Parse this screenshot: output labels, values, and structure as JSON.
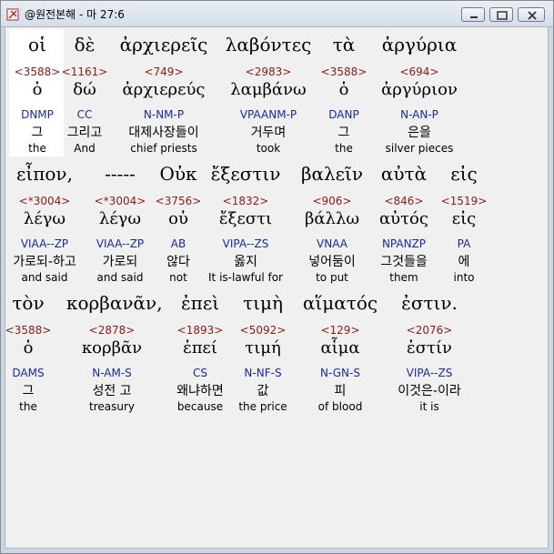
{
  "window": {
    "title": "@원전본해 - 마 27:6"
  },
  "rows": [
    [
      {
        "greek": "οἱ",
        "strong": "<3588>",
        "lemma": "ὁ",
        "morph": "DNMP",
        "korean": "그",
        "english": "the"
      },
      {
        "greek": "δὲ",
        "strong": "<1161>",
        "lemma": "δώ",
        "morph": "CC",
        "korean": "그리고",
        "english": "And"
      },
      {
        "greek": "ἀρχιερεῖς",
        "strong": "<749>",
        "lemma": "ἀρχιερεύς",
        "morph": "N-NM-P",
        "korean": "대제사장들이",
        "english": "chief priests"
      },
      {
        "greek": "λαβόντες",
        "strong": "<2983>",
        "lemma": "λαμβάνω",
        "morph": "VPAANM-P",
        "korean": "거두며",
        "english": "took"
      },
      {
        "greek": "τὰ",
        "strong": "<3588>",
        "lemma": "ὁ",
        "morph": "DANP",
        "korean": "그",
        "english": "the"
      },
      {
        "greek": "ἀργύρια",
        "strong": "<694>",
        "lemma": "ἀργύριον",
        "morph": "N-AN-P",
        "korean": "은을",
        "english": "silver pieces"
      }
    ],
    [
      {
        "greek": "εἶπον,",
        "strong": "<*3004>",
        "lemma": "λέγω",
        "morph": "VIAA--ZP",
        "korean": "가로되-하고",
        "english": "and said"
      },
      {
        "greek": "-----",
        "strong": "<*3004>",
        "lemma": "λέγω",
        "morph": "VIAA--ZP",
        "korean": "가로되",
        "english": "and said"
      },
      {
        "greek": "Οὐκ",
        "strong": "<3756>",
        "lemma": "οὐ",
        "morph": "AB",
        "korean": "않다",
        "english": "not"
      },
      {
        "greek": "ἔξεστιν",
        "strong": "<1832>",
        "lemma": "ἔξεστι",
        "morph": "VIPA--ZS",
        "korean": "옳지",
        "english": "It is-lawful for"
      },
      {
        "greek": "βαλεῖν",
        "strong": "<906>",
        "lemma": "βάλλω",
        "morph": "VNAA",
        "korean": "넣어둠이",
        "english": "to put"
      },
      {
        "greek": "αὐτὰ",
        "strong": "<846>",
        "lemma": "αὐτός",
        "morph": "NPANZP",
        "korean": "그것들을",
        "english": "them"
      },
      {
        "greek": "εἰς",
        "strong": "<1519>",
        "lemma": "εἰς",
        "morph": "PA",
        "korean": "에",
        "english": "into"
      }
    ],
    [
      {
        "greek": "τὸν",
        "strong": "<3588>",
        "lemma": "ὁ",
        "morph": "DAMS",
        "korean": "그",
        "english": "the"
      },
      {
        "greek": "κορβανᾶν,",
        "strong": "<2878>",
        "lemma": "κορβᾶν",
        "morph": "N-AM-S",
        "korean": "성전 고",
        "english": "treasury"
      },
      {
        "greek": "ἐπεὶ",
        "strong": "<1893>",
        "lemma": "ἐπεί",
        "morph": "CS",
        "korean": "왜냐하면",
        "english": "because"
      },
      {
        "greek": "τιμὴ",
        "strong": "<5092>",
        "lemma": "τιμή",
        "morph": "N-NF-S",
        "korean": "값",
        "english": "the price"
      },
      {
        "greek": "αἵματός",
        "strong": "<129>",
        "lemma": "αἷμα",
        "morph": "N-GN-S",
        "korean": "피",
        "english": "of blood"
      },
      {
        "greek": "ἐστιν.",
        "strong": "<2076>",
        "lemma": "ἐστίν",
        "morph": "VIPA--ZS",
        "korean": "이것은-이라",
        "english": "it is"
      }
    ]
  ]
}
